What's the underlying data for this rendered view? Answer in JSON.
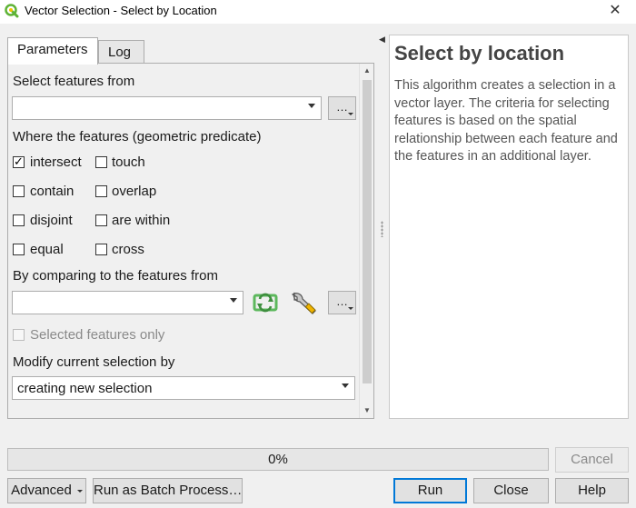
{
  "window": {
    "title": "Vector Selection - Select by Location",
    "close_glyph": "✕"
  },
  "tabs": [
    {
      "label": "Parameters",
      "active": true
    },
    {
      "label": "Log",
      "active": false
    }
  ],
  "params": {
    "select_from_label": "Select features from",
    "select_from_value": "",
    "predicate_label": "Where the features (geometric predicate)",
    "predicates": [
      {
        "label": "intersect",
        "checked": true
      },
      {
        "label": "touch",
        "checked": false
      },
      {
        "label": "contain",
        "checked": false
      },
      {
        "label": "overlap",
        "checked": false
      },
      {
        "label": "disjoint",
        "checked": false
      },
      {
        "label": "are within",
        "checked": false
      },
      {
        "label": "equal",
        "checked": false
      },
      {
        "label": "cross",
        "checked": false
      }
    ],
    "compare_label": "By comparing to the features from",
    "compare_value": "",
    "selected_only_label": "Selected features only",
    "modify_label": "Modify current selection by",
    "modify_value": "creating new selection",
    "dots": "…"
  },
  "help": {
    "title": "Select by location",
    "body": "This algorithm creates a selection in a vector layer. The criteria for selecting features is based on the spatial relationship between each feature and the features in an additional layer."
  },
  "progress": {
    "value": 0,
    "text": "0%"
  },
  "buttons": {
    "cancel": "Cancel",
    "advanced": "Advanced",
    "batch": "Run as Batch Process…",
    "run": "Run",
    "close": "Close",
    "help": "Help"
  },
  "colors": {
    "accent": "#0078d7",
    "qgis_green": "#5fb336",
    "refresh_green": "#5cb85c"
  },
  "icons": {
    "app": "qgis-icon",
    "refresh": "refresh-icon",
    "wrench": "wrench-icon"
  }
}
